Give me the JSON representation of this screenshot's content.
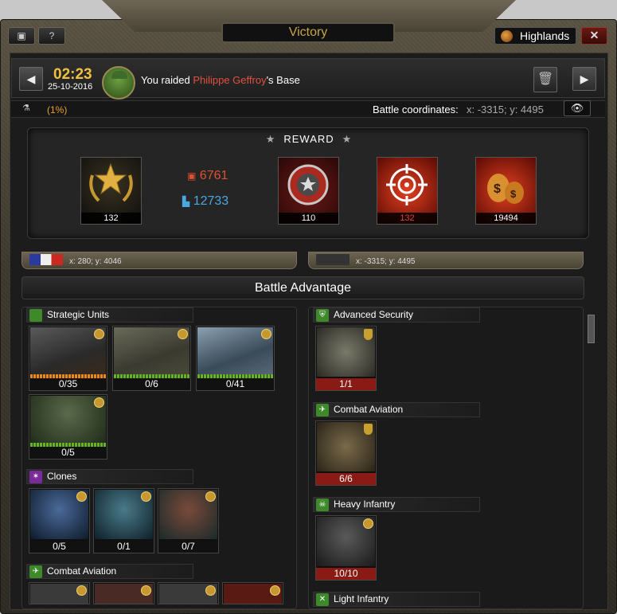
{
  "window": {
    "title": "Victory",
    "server_label": "Highlands",
    "help_label": "?",
    "close_label": "✕"
  },
  "battle": {
    "time": "02:23",
    "date": "25-10-2016",
    "message_prefix": "You raided",
    "opponent": "Philippe Geffroy",
    "message_suffix": "'s Base",
    "percent": "(1%)",
    "coords_label": "Battle coordinates:",
    "coords_value": "x: -3315; y: 4495"
  },
  "reward": {
    "title": "REWARD",
    "tiles": [
      {
        "name": "medal",
        "count": "132"
      },
      {
        "name": "commander-badge",
        "count": "110"
      },
      {
        "name": "target",
        "count": "132"
      },
      {
        "name": "money-bags",
        "count": "19494"
      }
    ],
    "resources": [
      {
        "name": "ore",
        "value": "6761",
        "color": "#e05030"
      },
      {
        "name": "titanium",
        "value": "12733",
        "color": "#4aa8e0"
      }
    ]
  },
  "strips": {
    "left_coords": "x: 280; y: 4046",
    "right_coords": "x: -3315; y: 4495"
  },
  "advantage": {
    "title": "Battle Advantage",
    "left_sections": [
      {
        "label": "Strategic Units",
        "units": [
          "0/35",
          "0/6",
          "0/41",
          "0/5"
        ]
      },
      {
        "label": "Clones",
        "units": [
          "0/5",
          "0/1",
          "0/7"
        ]
      },
      {
        "label": "Combat Aviation"
      }
    ],
    "right_sections": [
      {
        "label": "Advanced Security",
        "units": [
          "1/1"
        ]
      },
      {
        "label": "Combat Aviation",
        "units": [
          "6/6"
        ]
      },
      {
        "label": "Heavy Infantry",
        "units": [
          "10/10"
        ]
      },
      {
        "label": "Light Infantry"
      }
    ]
  }
}
